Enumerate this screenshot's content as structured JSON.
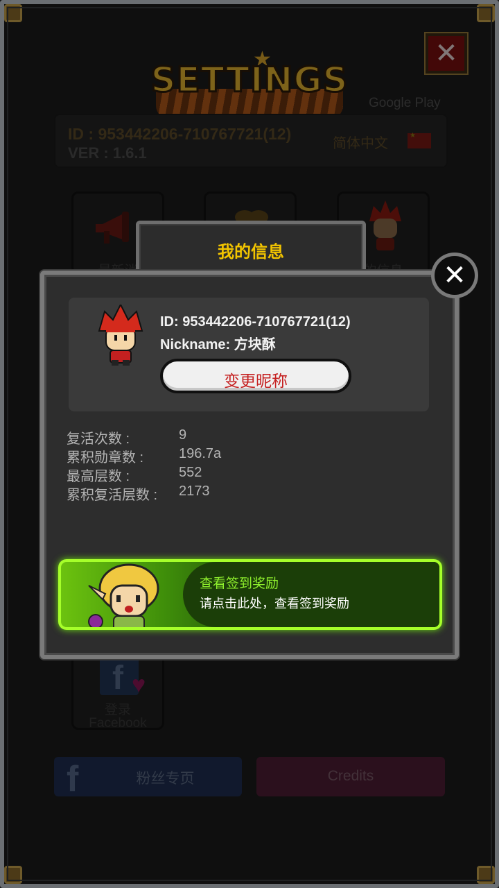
{
  "header": {
    "title": "SETTINGS",
    "store": "Google Play",
    "close_label": "✕"
  },
  "account": {
    "id_line": "ID : 953442206-710767721(12)",
    "version_line": "VER : 1.6.1",
    "language": "简体中文"
  },
  "tiles": [
    {
      "label": "最新消",
      "icon": "megaphone-icon"
    },
    {
      "label": "",
      "icon": "badge-icon"
    },
    {
      "label": "的信息",
      "icon": "character-icon"
    }
  ],
  "facebook_tile": {
    "line1": "登录",
    "line2": "Facebook"
  },
  "bottom_buttons": {
    "fan_page": "粉丝专页",
    "credits": "Credits"
  },
  "dialog": {
    "tab_title": "我的信息",
    "close_label": "✕",
    "profile": {
      "id_text": "ID: 953442206-710767721(12)",
      "nickname_text": "Nickname: 方块酥",
      "rename_button": "变更昵称"
    },
    "stats": [
      {
        "label": "复活次数 :",
        "value": "9"
      },
      {
        "label": "累积勋章数 :",
        "value": "196.7a"
      },
      {
        "label": "最高层数 :",
        "value": "552"
      },
      {
        "label": "累积复活层数 :",
        "value": "2173"
      }
    ],
    "reward": {
      "title": "查看签到奖励",
      "subtitle": "请点击此处，查看签到奖励"
    }
  },
  "colors": {
    "accent_yellow": "#f2c400",
    "rename_red": "#c52020",
    "reward_green": "#8ff02d",
    "fan_blue": "#1f2f52",
    "credits_maroon": "#4f1e36"
  }
}
